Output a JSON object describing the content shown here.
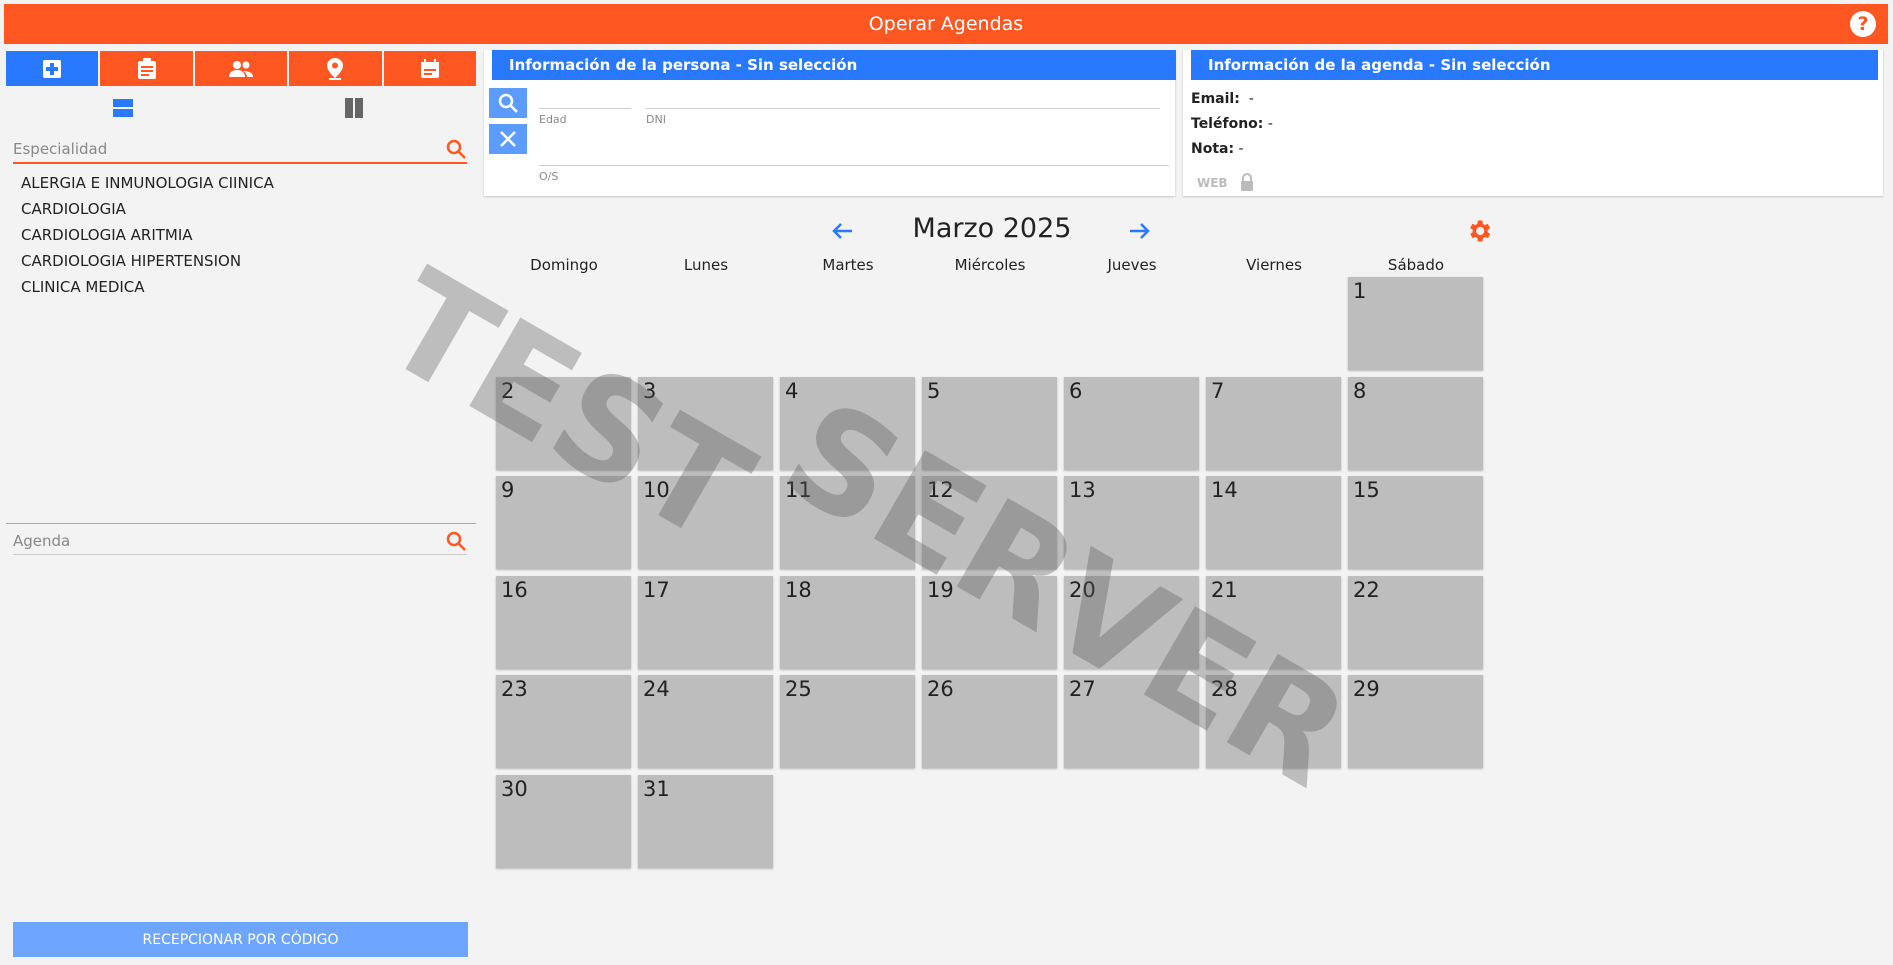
{
  "header": {
    "title": "Operar Agendas",
    "help": "?"
  },
  "left": {
    "tabs": [
      {
        "icon": "medical-plus-icon"
      },
      {
        "icon": "clipboard-icon"
      },
      {
        "icon": "people-icon"
      },
      {
        "icon": "location-pin-icon"
      },
      {
        "icon": "calendar-icon"
      }
    ],
    "specialty_placeholder": "Especialidad",
    "specialties": [
      "ALERGIA E INMUNOLOGIA CIINICA",
      "CARDIOLOGIA",
      "CARDIOLOGIA ARITMIA",
      "CARDIOLOGIA HIPERTENSION",
      "CLINICA MEDICA"
    ],
    "agenda_placeholder": "Agenda",
    "receive_button": "RECEPCIONAR POR CÓDIGO"
  },
  "person": {
    "header": "Información de la persona - Sin selección",
    "labels": {
      "age": "Edad",
      "dni": "DNI",
      "os": "O/S"
    }
  },
  "agenda_info": {
    "header": "Información de la agenda - Sin selección",
    "email_label": "Email:",
    "email_value": "-",
    "phone_label": "Teléfono:",
    "phone_value": "-",
    "note_label": "Nota:",
    "note_value": "-",
    "web_label": "WEB"
  },
  "calendar": {
    "month": "Marzo 2025",
    "weekdays": [
      "Domingo",
      "Lunes",
      "Martes",
      "Miércoles",
      "Jueves",
      "Viernes",
      "Sábado"
    ],
    "first_weekday": 6,
    "days_in_month": 31
  },
  "watermark": {
    "line1": "TEST",
    "line2": "SERVER"
  },
  "colors": {
    "accent": "#ff5722",
    "primary": "#2979ff",
    "day_cell": "#bdbdbd"
  }
}
